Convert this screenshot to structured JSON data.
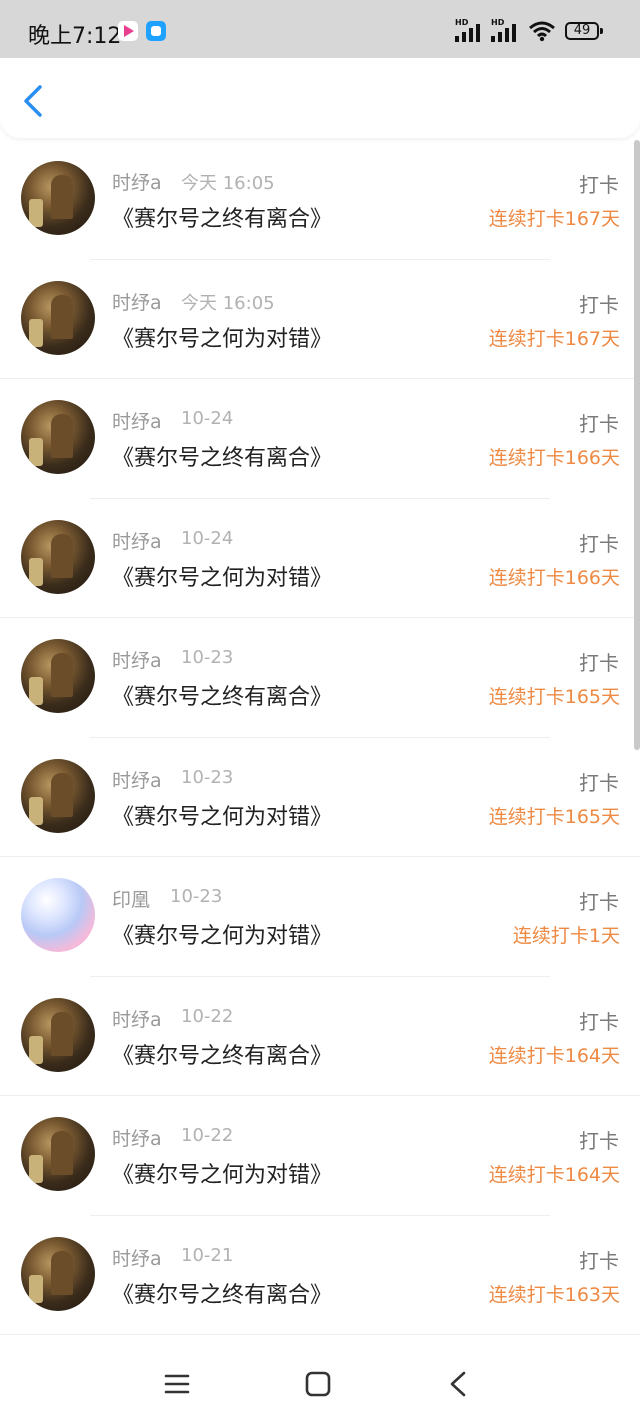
{
  "status_bar": {
    "time": "晚上7:12",
    "battery": "49",
    "signal_label_1": "HD",
    "signal_label_2": "HD"
  },
  "header": {
    "back_icon": "chevron-left-icon",
    "accent_color": "#2a8ef0"
  },
  "colors": {
    "streak": "#ee8a43",
    "name": "#9a9a9a",
    "title": "#222222"
  },
  "feed": {
    "items": [
      {
        "user": "时纾a",
        "time": "今天 16:05",
        "title": "《赛尔号之终有离合》",
        "action": "打卡",
        "streak": "连续打卡167天",
        "avatar": "dark"
      },
      {
        "user": "时纾a",
        "time": "今天 16:05",
        "title": "《赛尔号之何为对错》",
        "action": "打卡",
        "streak": "连续打卡167天",
        "avatar": "dark"
      },
      {
        "user": "时纾a",
        "time": "10-24",
        "title": "《赛尔号之终有离合》",
        "action": "打卡",
        "streak": "连续打卡166天",
        "avatar": "dark"
      },
      {
        "user": "时纾a",
        "time": "10-24",
        "title": "《赛尔号之何为对错》",
        "action": "打卡",
        "streak": "连续打卡166天",
        "avatar": "dark"
      },
      {
        "user": "时纾a",
        "time": "10-23",
        "title": "《赛尔号之终有离合》",
        "action": "打卡",
        "streak": "连续打卡165天",
        "avatar": "dark"
      },
      {
        "user": "时纾a",
        "time": "10-23",
        "title": "《赛尔号之何为对错》",
        "action": "打卡",
        "streak": "连续打卡165天",
        "avatar": "dark"
      },
      {
        "user": "印凰",
        "time": "10-23",
        "title": "《赛尔号之何为对错》",
        "action": "打卡",
        "streak": "连续打卡1天",
        "avatar": "anime"
      },
      {
        "user": "时纾a",
        "time": "10-22",
        "title": "《赛尔号之终有离合》",
        "action": "打卡",
        "streak": "连续打卡164天",
        "avatar": "dark"
      },
      {
        "user": "时纾a",
        "time": "10-22",
        "title": "《赛尔号之何为对错》",
        "action": "打卡",
        "streak": "连续打卡164天",
        "avatar": "dark"
      },
      {
        "user": "时纾a",
        "time": "10-21",
        "title": "《赛尔号之终有离合》",
        "action": "打卡",
        "streak": "连续打卡163天",
        "avatar": "dark"
      }
    ]
  },
  "nav_bar": {
    "menu_icon": "menu-icon",
    "home_icon": "home-square-icon",
    "back_icon": "back-triangle-icon"
  }
}
